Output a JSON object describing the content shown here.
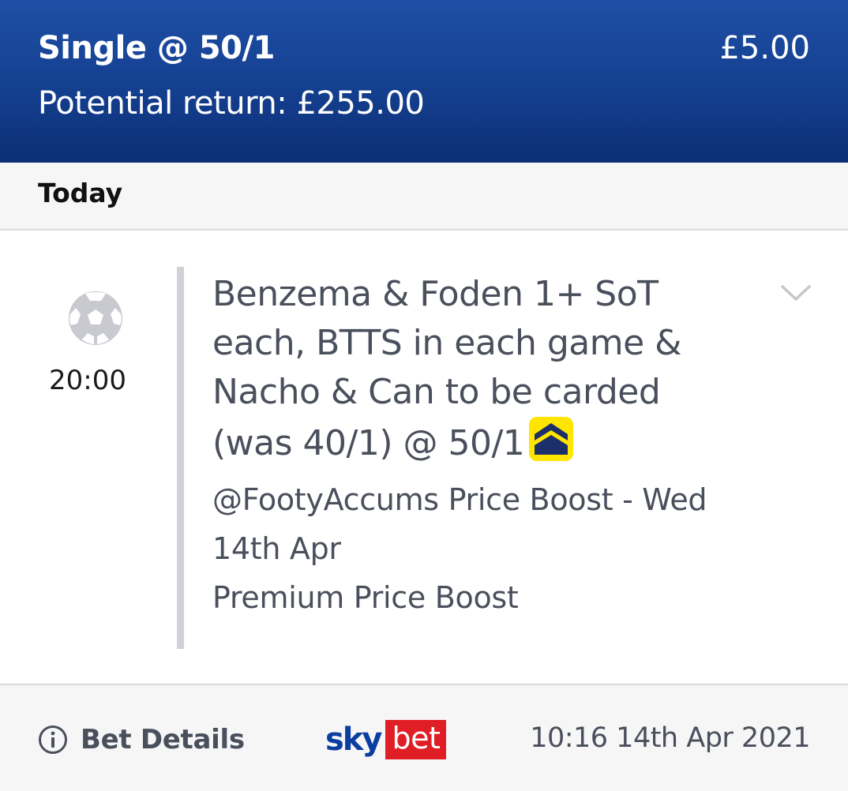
{
  "header": {
    "bet_type": "Single @ 50/1",
    "stake": "£5.00",
    "potential_return": "Potential return: £255.00"
  },
  "date_bar": {
    "label": "Today"
  },
  "event": {
    "sport_icon": "football-icon",
    "time": "20:00",
    "selection": "Benzema & Foden 1+ SoT each, BTTS in each game & Nacho & Can to be carded (was 40/1) @ 50/1",
    "boost_icon": "price-boost-icon",
    "market_lines": [
      "@FootyAccums Price Boost - Wed",
      "14th Apr",
      "Premium Price Boost"
    ],
    "expand_icon": "chevron-down-icon"
  },
  "footer": {
    "details_label": "Bet Details",
    "details_icon": "info-icon",
    "brand_sky": "sky",
    "brand_bet": "bet",
    "placed_at": "10:16 14th Apr 2021"
  },
  "colors": {
    "header_blue": "#143f8f",
    "boost_yellow": "#ffe500",
    "brand_red": "#e01e26",
    "brand_blue": "#0b3ea0",
    "text_grey": "#4a4f5c"
  }
}
